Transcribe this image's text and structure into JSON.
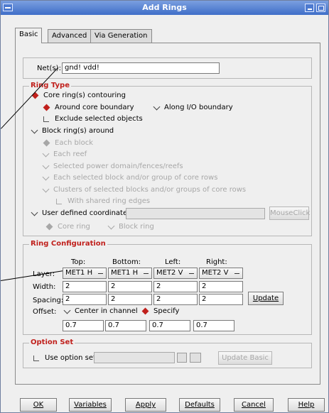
{
  "window": {
    "title": "Add Rings"
  },
  "tabs": [
    {
      "label": "Basic"
    },
    {
      "label": "Advanced"
    },
    {
      "label": "Via Generation"
    }
  ],
  "net": {
    "label": "Net(s):",
    "value": "gnd! vdd!"
  },
  "ring_type": {
    "title": "Ring Type",
    "core_ring": "Core ring(s) contouring",
    "around_core": "Around core boundary",
    "along_io": "Along I/O boundary",
    "exclude_selected": "Exclude selected objects",
    "block_rings": "Block ring(s) around",
    "each_block": "Each block",
    "each_reef": "Each reef",
    "selected_domain": "Selected power domain/fences/reefs",
    "each_selected_block": "Each selected block and/or group of core rows",
    "clusters": "Clusters of selected blocks and/or groups of core rows",
    "with_shared": "With shared ring edges",
    "user_defined": "User defined coordinates:",
    "user_value": "",
    "mouseclick": "MouseClick",
    "core_ring_opt": "Core ring",
    "block_ring_opt": "Block ring"
  },
  "ring_config": {
    "title": "Ring Configuration",
    "headers": [
      "Top:",
      "Bottom:",
      "Left:",
      "Right:"
    ],
    "layer_label": "Layer:",
    "layers": [
      "MET1 H",
      "MET1 H",
      "MET2 V",
      "MET2 V"
    ],
    "width_label": "Width:",
    "widths": [
      "2",
      "2",
      "2",
      "2"
    ],
    "spacing_label": "Spacing:",
    "spacings": [
      "2",
      "2",
      "2",
      "2"
    ],
    "update": "Update",
    "offset_label": "Offset:",
    "center_in_channel": "Center in channel",
    "specify": "Specify",
    "offsets": [
      "0.7",
      "0.7",
      "0.7",
      "0.7"
    ]
  },
  "option_set": {
    "title": "Option Set",
    "use_option_set": "Use option set:",
    "value": "",
    "update_basic": "Update Basic"
  },
  "buttons": {
    "ok": "OK",
    "variables": "Variables",
    "apply": "Apply",
    "defaults": "Defaults",
    "cancel": "Cancel",
    "help": "Help"
  },
  "colors": {
    "accent": "#c0201c",
    "titlebar": "#3f6ec8"
  }
}
